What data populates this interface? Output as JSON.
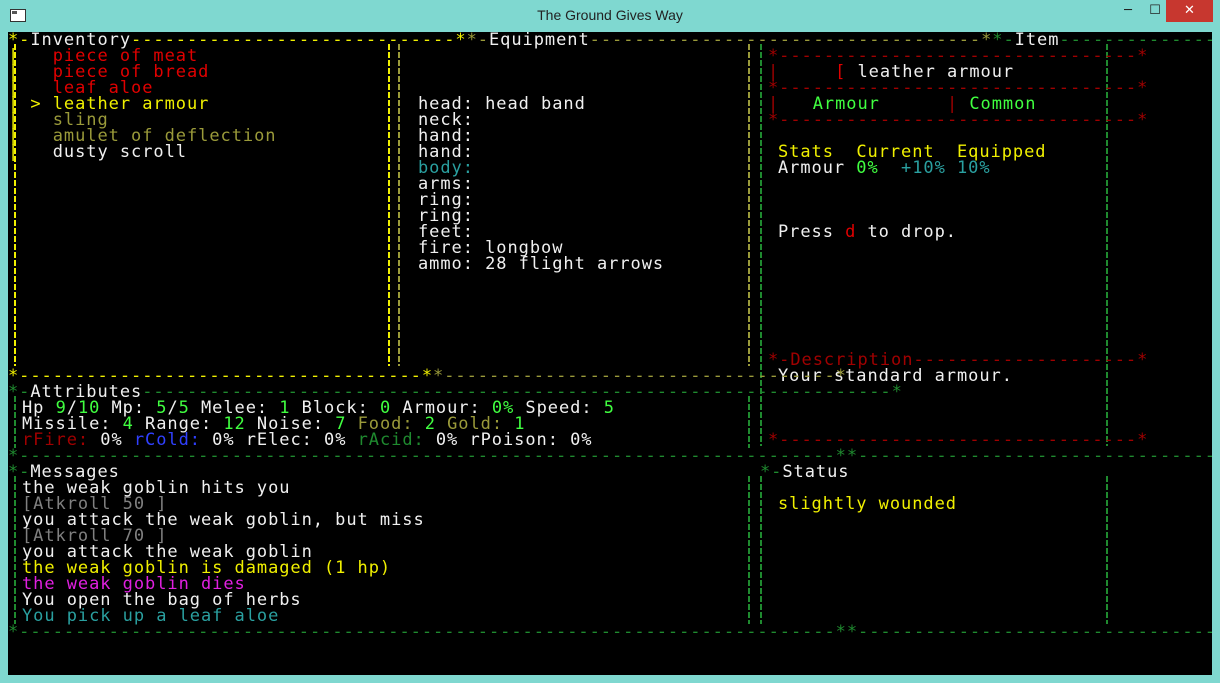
{
  "window": {
    "title": "The Ground Gives Way",
    "min_glyph": "─",
    "max_glyph": "☐",
    "close_glyph": "✕"
  },
  "inventory": {
    "title": "Inventory",
    "cursor": ">",
    "items": [
      "piece of meat",
      "piece of bread",
      "leaf aloe",
      "leather armour",
      "sling",
      "amulet of deflection",
      "dusty scroll"
    ]
  },
  "equipment": {
    "title": "Equipment",
    "slots": [
      {
        "slot": "head:",
        "item": "head band"
      },
      {
        "slot": "neck:",
        "item": ""
      },
      {
        "slot": "hand:",
        "item": ""
      },
      {
        "slot": "hand:",
        "item": ""
      },
      {
        "slot": "body:",
        "item": ""
      },
      {
        "slot": "arms:",
        "item": ""
      },
      {
        "slot": "ring:",
        "item": ""
      },
      {
        "slot": "ring:",
        "item": ""
      },
      {
        "slot": "feet:",
        "item": ""
      },
      {
        "slot": "fire:",
        "item": "longbow"
      },
      {
        "slot": "ammo:",
        "item": "28 flight arrows"
      }
    ]
  },
  "item": {
    "title": "Item",
    "icon": "[",
    "name": "leather armour",
    "type": "Armour",
    "rarity": "Common",
    "stats_header": [
      "Stats",
      "Current",
      "Equipped"
    ],
    "stat_name": "Armour",
    "stat_current": "0%",
    "stat_change": "+10%",
    "stat_equipped": "10%",
    "drop_pre": "Press",
    "drop_key": "d",
    "drop_post": "to drop.",
    "description_title": "Description",
    "description": "Your standard armour."
  },
  "attributes": {
    "title": "Attributes",
    "hp_label": "Hp",
    "hp": "9",
    "hp_max": "10",
    "mp_label": "Mp:",
    "mp": "5",
    "mp_max": "5",
    "melee_label": "Melee:",
    "melee": "1",
    "block_label": "Block:",
    "block": "0",
    "armour_label": "Armour:",
    "armour": "0%",
    "speed_label": "Speed:",
    "speed": "5",
    "missile_label": "Missile:",
    "missile": "4",
    "range_label": "Range:",
    "range": "12",
    "noise_label": "Noise:",
    "noise": "7",
    "food_label": "Food:",
    "food": "2",
    "gold_label": "Gold:",
    "gold": "1",
    "rfire_label": "rFire:",
    "rfire": "0%",
    "rcold_label": "rCold:",
    "rcold": "0%",
    "relec_label": "rElec:",
    "relec": "0%",
    "racid_label": "rAcid:",
    "racid": "0%",
    "rpoison_label": "rPoison:",
    "rpoison": "0%"
  },
  "messages": {
    "title": "Messages",
    "lines": [
      "the weak goblin hits you",
      "[Atkroll 50 ]",
      "you attack the weak goblin, but miss",
      "[Atkroll 70 ]",
      "you attack the weak goblin",
      "the weak goblin is damaged (1 hp)",
      "the weak goblin dies",
      "You open the bag of herbs",
      "You pick up a leaf aloe"
    ]
  },
  "status": {
    "title": "Status",
    "text": "slightly wounded"
  },
  "colors": {
    "terminal_bg": "#000000",
    "titlebar": "#7fd8d0",
    "yellow": "#f0f000",
    "green": "#00c800",
    "red": "#e00000"
  }
}
